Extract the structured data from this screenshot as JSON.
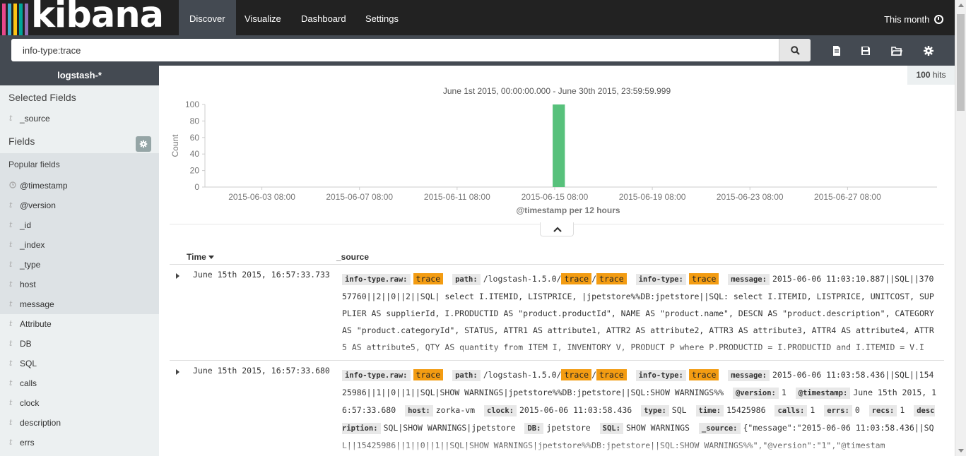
{
  "brand": {
    "name": "kibana",
    "stripe_colors": [
      "#e8488b",
      "#3caed2",
      "#fec514",
      "#00a69b",
      "#9170b8"
    ]
  },
  "nav": {
    "tabs": [
      {
        "label": "Discover",
        "active": true
      },
      {
        "label": "Visualize",
        "active": false
      },
      {
        "label": "Dashboard",
        "active": false
      },
      {
        "label": "Settings",
        "active": false
      }
    ],
    "time_range": "This month"
  },
  "search": {
    "query": "info-type:trace",
    "icons": [
      "search-icon",
      "new-search-icon",
      "save-icon",
      "open-icon",
      "settings-icon"
    ]
  },
  "sidebar": {
    "index_pattern": "logstash-*",
    "selected_fields_title": "Selected Fields",
    "selected_fields": [
      {
        "type": "t",
        "name": "_source"
      }
    ],
    "fields_title": "Fields",
    "popular_title": "Popular fields",
    "popular_fields": [
      {
        "type": "clock",
        "name": "@timestamp"
      },
      {
        "type": "t",
        "name": "@version"
      },
      {
        "type": "t",
        "name": "_id"
      },
      {
        "type": "t",
        "name": "_index"
      },
      {
        "type": "t",
        "name": "_type"
      },
      {
        "type": "t",
        "name": "host"
      },
      {
        "type": "t",
        "name": "message"
      }
    ],
    "other_fields": [
      {
        "type": "t",
        "name": "Attribute"
      },
      {
        "type": "t",
        "name": "DB"
      },
      {
        "type": "t",
        "name": "SQL"
      },
      {
        "type": "t",
        "name": "calls"
      },
      {
        "type": "t",
        "name": "clock"
      },
      {
        "type": "t",
        "name": "description"
      },
      {
        "type": "t",
        "name": "errs"
      }
    ]
  },
  "hits": {
    "count": "100",
    "label": "hits"
  },
  "histogram": {
    "range_label": "June 1st 2015, 00:00:00.000 - June 30th 2015, 23:59:59.999",
    "xlabel_prefix": "@timestamp per ",
    "xlabel_interval": "12 hours"
  },
  "chart_data": {
    "type": "bar",
    "ylabel": "Count",
    "ylim": [
      0,
      100
    ],
    "yticks": [
      0,
      20,
      40,
      60,
      80,
      100
    ],
    "x_tick_labels": [
      "2015-06-03 08:00",
      "2015-06-07 08:00",
      "2015-06-11 08:00",
      "2015-06-15 08:00",
      "2015-06-19 08:00",
      "2015-06-23 08:00",
      "2015-06-27 08:00"
    ],
    "bars": [
      {
        "x": "2015-06-15 12:00",
        "value": 100
      }
    ],
    "bar_color": "#57c17b",
    "grid": false
  },
  "table": {
    "headers": {
      "time": "Time",
      "source": "_source"
    },
    "rows": [
      {
        "time": "June 15th 2015, 16:57:33.733",
        "source": [
          {
            "k": "info-type.raw:",
            "v": [
              {
                "h": "trace"
              }
            ]
          },
          {
            "k": "path:",
            "v": [
              {
                "t": "/logstash-1.5.0/"
              },
              {
                "h": "trace"
              },
              {
                "t": "/"
              },
              {
                "h": "trace"
              }
            ]
          },
          {
            "k": "info-type:",
            "v": [
              {
                "h": "trace"
              }
            ]
          },
          {
            "k": "message:",
            "v": [
              {
                "t": "2015-06-06 11:03:10.887||SQL||37057760||2||0||2||SQL| select I.ITEMID, LISTPRICE, |jpetstore%%DB:jpetstore||SQL: select I.ITEMID, LISTPRICE, UNITCOST, SUPPLIER AS supplierId, I.PRODUCTID AS \"product.productId\", NAME AS \"product.name\", DESCN AS \"product.description\", CATEGORY AS \"product.categoryId\", STATUS, ATTR1 AS attribute1, ATTR2 AS attribute2, ATTR3 AS attribute3, ATTR4 AS attribute4, ATTR5 AS attribute5, QTY AS quantity from ITEM I, INVENTORY V, PRODUCT P where P.PRODUCTID = I.PRODUCTID and I.ITEMID = V.I"
              }
            ]
          }
        ]
      },
      {
        "time": "June 15th 2015, 16:57:33.680",
        "source": [
          {
            "k": "info-type.raw:",
            "v": [
              {
                "h": "trace"
              }
            ]
          },
          {
            "k": "path:",
            "v": [
              {
                "t": "/logstash-1.5.0/"
              },
              {
                "h": "trace"
              },
              {
                "t": "/"
              },
              {
                "h": "trace"
              }
            ]
          },
          {
            "k": "info-type:",
            "v": [
              {
                "h": "trace"
              }
            ]
          },
          {
            "k": "message:",
            "v": [
              {
                "t": "2015-06-06 11:03:58.436||SQL||15425986||1||0||1||SQL|SHOW WARNINGS|jpetstore%%DB:jpetstore||SQL:SHOW WARNINGS%%"
              }
            ]
          },
          {
            "k": "@version:",
            "v": [
              {
                "t": "1"
              }
            ]
          },
          {
            "k": "@timestamp:",
            "v": [
              {
                "t": "June 15th 2015, 16:57:33.680"
              }
            ]
          },
          {
            "k": "host:",
            "v": [
              {
                "t": "zorka-vm"
              }
            ]
          },
          {
            "k": "clock:",
            "v": [
              {
                "t": "2015-06-06 11:03:58.436"
              }
            ]
          },
          {
            "k": "type:",
            "v": [
              {
                "t": "SQL"
              }
            ]
          },
          {
            "k": "time:",
            "v": [
              {
                "t": "15425986"
              }
            ]
          },
          {
            "k": "calls:",
            "v": [
              {
                "t": "1"
              }
            ]
          },
          {
            "k": "errs:",
            "v": [
              {
                "t": "0"
              }
            ]
          },
          {
            "k": "recs:",
            "v": [
              {
                "t": "1"
              }
            ]
          },
          {
            "k": "description:",
            "v": [
              {
                "t": "SQL|SHOW WARNINGS|jpetstore"
              }
            ]
          },
          {
            "k": "DB:",
            "v": [
              {
                "t": "jpetstore"
              }
            ]
          },
          {
            "k": "SQL:",
            "v": [
              {
                "t": "SHOW WARNINGS"
              }
            ]
          },
          {
            "k": "_source:",
            "v": [
              {
                "t": "{\"message\":\"2015-06-06 11:03:58.436||SQL||15425986||1||0||1||SQL|SHOW WARNINGS|jpetstore%%DB:jpetstore||SQL:SHOW WARNINGS%%\",\"@version\":\"1\",\"@timestam"
              }
            ]
          }
        ]
      }
    ]
  }
}
